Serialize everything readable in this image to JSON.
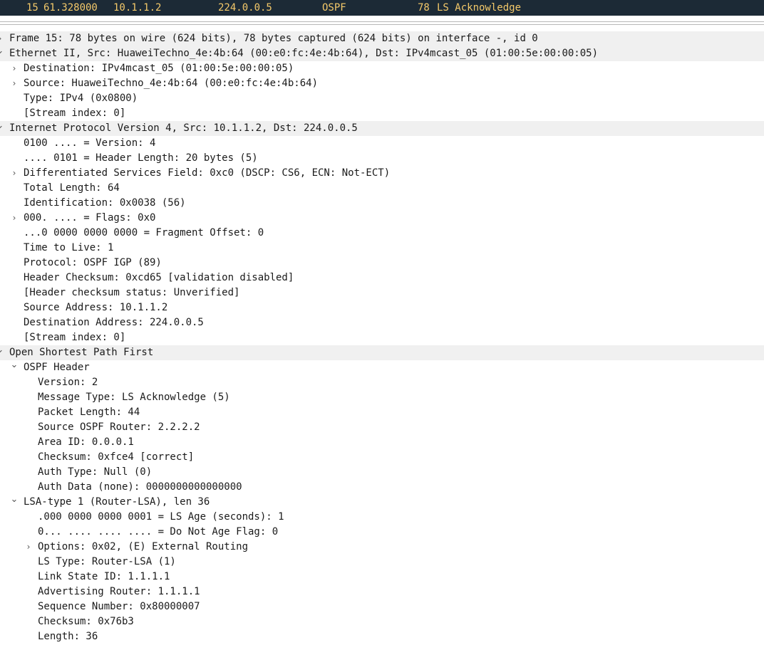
{
  "packet_list": {
    "selected_row": {
      "no": "15",
      "time": "61.328000",
      "source": "10.1.1.2",
      "destination": "224.0.0.5",
      "protocol": "OSPF",
      "length": "78",
      "info": "LS Acknowledge"
    }
  },
  "details": [
    {
      "text": "Frame 15: 78 bytes on wire (624 bits), 78 bytes captured (624 bits) on interface -, id 0",
      "level": 0,
      "toggle": "chevron-right-icon"
    },
    {
      "text": "Ethernet II, Src: HuaweiTechno_4e:4b:64 (00:e0:fc:4e:4b:64), Dst: IPv4mcast_05 (01:00:5e:00:00:05)",
      "level": 0,
      "toggle": "chevron-down-icon"
    },
    {
      "text": "Destination: IPv4mcast_05 (01:00:5e:00:00:05)",
      "level": 1,
      "toggle": "chevron-right-icon"
    },
    {
      "text": "Source: HuaweiTechno_4e:4b:64 (00:e0:fc:4e:4b:64)",
      "level": 1,
      "toggle": "chevron-right-icon"
    },
    {
      "text": "Type: IPv4 (0x0800)",
      "level": 1,
      "toggle": ""
    },
    {
      "text": "[Stream index: 0]",
      "level": 1,
      "toggle": ""
    },
    {
      "text": "Internet Protocol Version 4, Src: 10.1.1.2, Dst: 224.0.0.5",
      "level": 0,
      "toggle": "chevron-down-icon"
    },
    {
      "text": "0100 .... = Version: 4",
      "level": 1,
      "toggle": ""
    },
    {
      "text": ".... 0101 = Header Length: 20 bytes (5)",
      "level": 1,
      "toggle": ""
    },
    {
      "text": "Differentiated Services Field: 0xc0 (DSCP: CS6, ECN: Not-ECT)",
      "level": 1,
      "toggle": "chevron-right-icon"
    },
    {
      "text": "Total Length: 64",
      "level": 1,
      "toggle": ""
    },
    {
      "text": "Identification: 0x0038 (56)",
      "level": 1,
      "toggle": ""
    },
    {
      "text": "000. .... = Flags: 0x0",
      "level": 1,
      "toggle": "chevron-right-icon"
    },
    {
      "text": "...0 0000 0000 0000 = Fragment Offset: 0",
      "level": 1,
      "toggle": ""
    },
    {
      "text": "Time to Live: 1",
      "level": 1,
      "toggle": ""
    },
    {
      "text": "Protocol: OSPF IGP (89)",
      "level": 1,
      "toggle": ""
    },
    {
      "text": "Header Checksum: 0xcd65 [validation disabled]",
      "level": 1,
      "toggle": ""
    },
    {
      "text": "[Header checksum status: Unverified]",
      "level": 1,
      "toggle": ""
    },
    {
      "text": "Source Address: 10.1.1.2",
      "level": 1,
      "toggle": ""
    },
    {
      "text": "Destination Address: 224.0.0.5",
      "level": 1,
      "toggle": ""
    },
    {
      "text": "[Stream index: 0]",
      "level": 1,
      "toggle": ""
    },
    {
      "text": "Open Shortest Path First",
      "level": 0,
      "toggle": "chevron-down-icon"
    },
    {
      "text": "OSPF Header",
      "level": 1,
      "toggle": "chevron-down-icon"
    },
    {
      "text": "Version: 2",
      "level": 2,
      "toggle": ""
    },
    {
      "text": "Message Type: LS Acknowledge (5)",
      "level": 2,
      "toggle": ""
    },
    {
      "text": "Packet Length: 44",
      "level": 2,
      "toggle": ""
    },
    {
      "text": "Source OSPF Router: 2.2.2.2",
      "level": 2,
      "toggle": ""
    },
    {
      "text": "Area ID: 0.0.0.1",
      "level": 2,
      "toggle": ""
    },
    {
      "text": "Checksum: 0xfce4 [correct]",
      "level": 2,
      "toggle": ""
    },
    {
      "text": "Auth Type: Null (0)",
      "level": 2,
      "toggle": ""
    },
    {
      "text": "Auth Data (none): 0000000000000000",
      "level": 2,
      "toggle": ""
    },
    {
      "text": "LSA-type 1 (Router-LSA), len 36",
      "level": 1,
      "toggle": "chevron-down-icon"
    },
    {
      "text": ".000 0000 0000 0001 = LS Age (seconds): 1",
      "level": 2,
      "toggle": ""
    },
    {
      "text": "0... .... .... .... = Do Not Age Flag: 0",
      "level": 2,
      "toggle": ""
    },
    {
      "text": "Options: 0x02, (E) External Routing",
      "level": 2,
      "toggle": "chevron-right-icon"
    },
    {
      "text": "LS Type: Router-LSA (1)",
      "level": 2,
      "toggle": ""
    },
    {
      "text": "Link State ID: 1.1.1.1",
      "level": 2,
      "toggle": ""
    },
    {
      "text": "Advertising Router: 1.1.1.1",
      "level": 2,
      "toggle": ""
    },
    {
      "text": "Sequence Number: 0x80000007",
      "level": 2,
      "toggle": ""
    },
    {
      "text": "Checksum: 0x76b3",
      "level": 2,
      "toggle": ""
    },
    {
      "text": "Length: 36",
      "level": 2,
      "toggle": ""
    }
  ]
}
